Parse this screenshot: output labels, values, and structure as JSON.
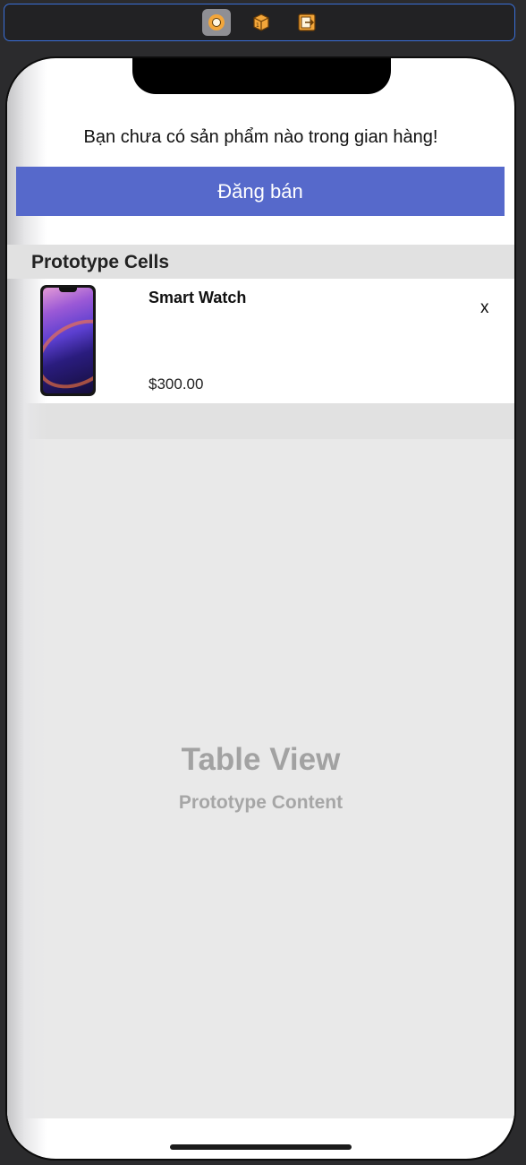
{
  "dock": {
    "items": [
      {
        "icon": "view-controller-icon",
        "selected": true
      },
      {
        "icon": "first-responder-icon",
        "selected": false
      },
      {
        "icon": "exit-icon",
        "selected": false
      }
    ],
    "accent_color": "#f3a63a"
  },
  "screen": {
    "empty_message": "Bạn chưa có sản phẩm nào trong gian hàng!",
    "sell_button_label": "Đăng bán",
    "sell_button_color": "#5669cb"
  },
  "table": {
    "section_header": "Prototype Cells",
    "cell": {
      "image_icon": "phone-image",
      "name": "Smart Watch",
      "price": "$300.00",
      "delete_label": "x"
    },
    "placeholder_title": "Table View",
    "placeholder_subtitle": "Prototype Content"
  }
}
